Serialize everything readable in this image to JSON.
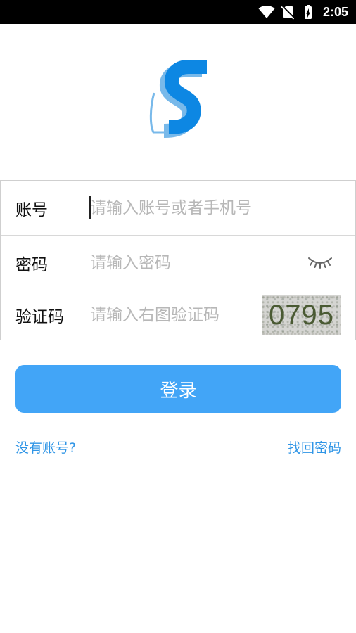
{
  "status_bar": {
    "time": "2:05",
    "wifi_icon": "wifi-icon",
    "sim_icon": "no-sim-icon",
    "battery_icon": "battery-charging-icon",
    "background": "#000000",
    "foreground": "#ffffff"
  },
  "logo": {
    "icon": "s-logo-icon",
    "primary_color": "#0d87e3",
    "secondary_color": "#78b9ea"
  },
  "form": {
    "account": {
      "label": "账号",
      "placeholder": "请输入账号或者手机号",
      "value": ""
    },
    "password": {
      "label": "密码",
      "placeholder": "请输入密码",
      "value": "",
      "toggle_icon": "eye-closed-icon"
    },
    "captcha": {
      "label": "验证码",
      "placeholder": "请输入右图验证码",
      "value": "",
      "image_text": "0795"
    }
  },
  "login_button": {
    "label": "登录",
    "color": "#42a5f7"
  },
  "links": {
    "register": "没有账号?",
    "forgot_password": "找回密码",
    "color": "#2f95e6"
  }
}
